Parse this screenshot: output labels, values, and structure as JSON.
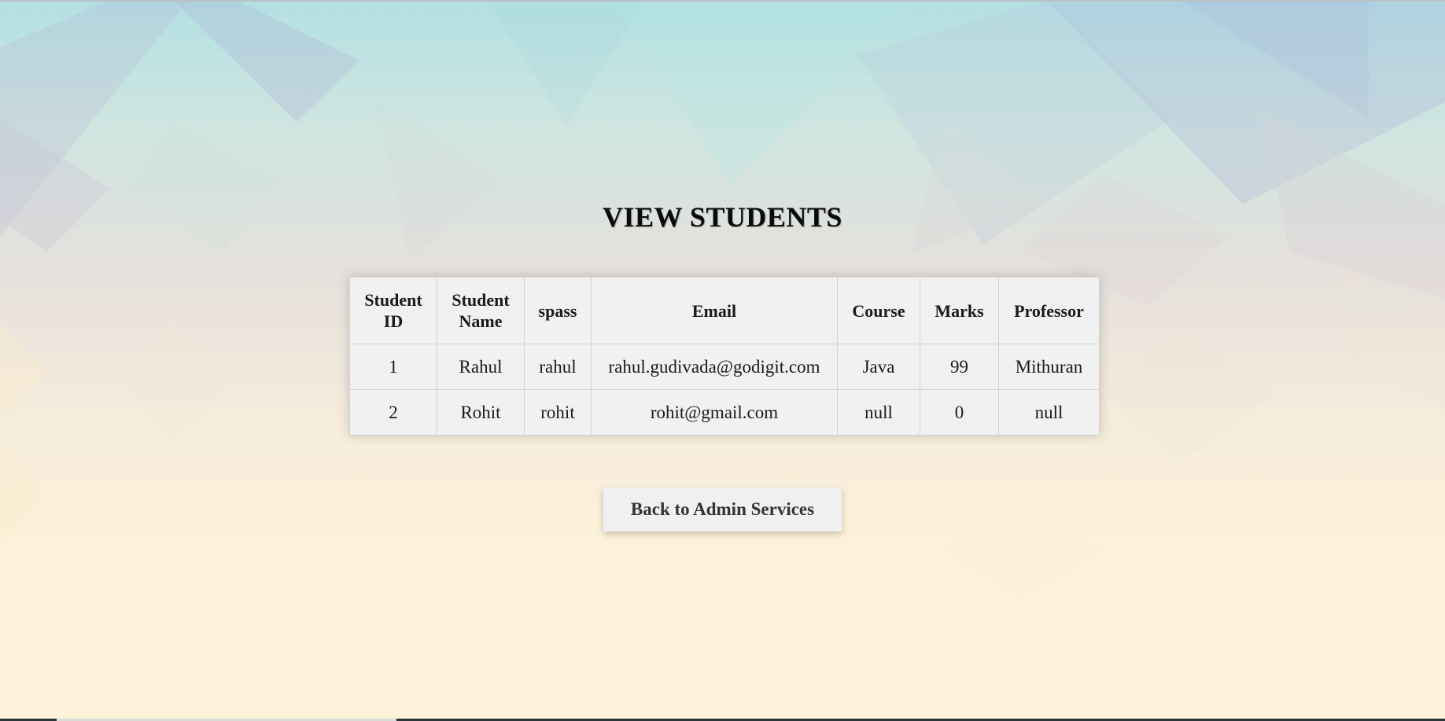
{
  "page": {
    "title": "VIEW STUDENTS"
  },
  "table": {
    "headers": [
      "Student ID",
      "Student Name",
      "spass",
      "Email",
      "Course",
      "Marks",
      "Professor"
    ],
    "rows": [
      [
        "1",
        "Rahul",
        "rahul",
        "rahul.gudivada@godigit.com",
        "Java",
        "99",
        "Mithuran"
      ],
      [
        "2",
        "Rohit",
        "rohit",
        "rohit@gmail.com",
        "null",
        "0",
        "null"
      ]
    ]
  },
  "actions": {
    "back_label": "Back to Admin Services"
  },
  "colors": {
    "table_bg": "#f1f1f1",
    "button_bg": "#f0f0f0",
    "title_text": "#0a0a0a"
  }
}
